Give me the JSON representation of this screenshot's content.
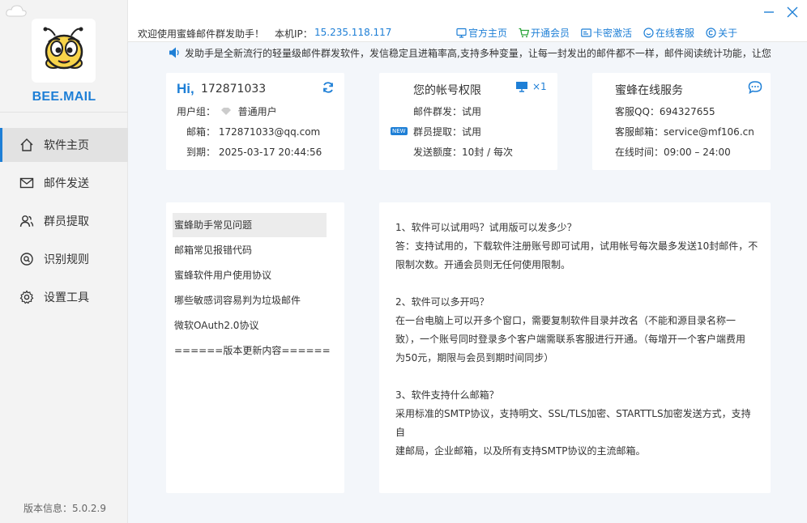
{
  "sidebar": {
    "brand": "BEE.MAIL",
    "items": [
      {
        "label": "软件主页",
        "icon": "home-icon"
      },
      {
        "label": "邮件发送",
        "icon": "mail-icon"
      },
      {
        "label": "群员提取",
        "icon": "users-icon"
      },
      {
        "label": "识别规则",
        "icon": "rule-icon"
      },
      {
        "label": "设置工具",
        "icon": "gear-icon"
      }
    ],
    "version": "版本信息：5.0.2.9"
  },
  "topbar": {
    "welcome": "欢迎使用蜜蜂邮件群发助手！",
    "ip_label": "本机IP：",
    "ip_value": "15.235.118.117",
    "links": [
      "官方主页",
      "开通会员",
      "卡密激活",
      "在线客服",
      "关于"
    ]
  },
  "marquee": "发助手是全新流行的轻量级邮件群发软件，发信稳定且进箱率高,支持多种变量，让每一封发出的邮件都不一样，邮件阅读统计功能，让您",
  "account": {
    "greeting": "Hi,",
    "username": "172871033",
    "group_label": "用户组：",
    "group_value": "普通用户",
    "email_label": "邮箱：",
    "email_value": "172871033@qq.com",
    "expire_label": "到期：",
    "expire_value": "2025-03-17 20:44:56"
  },
  "permissions": {
    "title": "您的帐号权限",
    "device_count": "×1",
    "new_badge": "NEW",
    "rows": [
      {
        "label": "邮件群发：",
        "value": "试用"
      },
      {
        "label": "群员提取：",
        "value": "试用"
      },
      {
        "label": "发送额度：",
        "value": "10封 / 每次"
      }
    ]
  },
  "service": {
    "title": "蜜蜂在线服务",
    "rows": [
      {
        "label": "客服QQ：",
        "value": "694327655"
      },
      {
        "label": "客服邮箱：",
        "value": "service@mf106.cn"
      },
      {
        "label": "在线时间：",
        "value": "09:00 – 24:00"
      }
    ]
  },
  "faq": {
    "items": [
      "蜜蜂助手常见问题",
      "邮箱常见报错代码",
      "蜜蜂软件用户使用协议",
      "哪些敏感词容易判为垃圾邮件",
      "微软OAuth2.0协议",
      "======版本更新内容======"
    ],
    "answer": [
      "1、软件可以试用吗？试用版可以发多少？",
      "答：支持试用的，下载软件注册账号即可试用，试用帐号每次最多发送10封邮件，不",
      "限制次数。开通会员则无任何使用限制。",
      "",
      "2、软件可以多开吗？",
      "在一台电脑上可以开多个窗口，需要复制软件目录并改名（不能和源目录名称一",
      "致），一个账号同时登录多个客户端需联系客服进行开通。（每增开一个客户端费用",
      "为50元，期限与会员到期时间同步）",
      "",
      "3、软件支持什么邮箱？",
      "采用标准的SMTP协议，支持明文、SSL/TLS加密、STARTTLS加密发送方式，支持自",
      "建邮局，企业邮箱，以及所有支持SMTP协议的主流邮箱。"
    ]
  },
  "colors": {
    "accent": "#1e7fd6",
    "green": "#2aa53a"
  }
}
